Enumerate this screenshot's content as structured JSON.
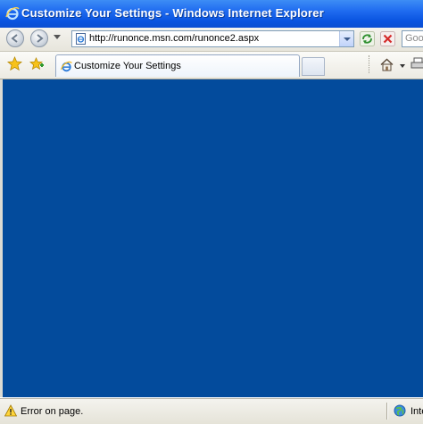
{
  "window": {
    "title": "Customize Your Settings - Windows Internet Explorer",
    "icon": "ie-logo-icon"
  },
  "address_bar": {
    "url": "http://runonce.msn.com/runonce2.aspx",
    "page_icon": "page-icon"
  },
  "search": {
    "placeholder": "Goo"
  },
  "tabs": [
    {
      "label": "Customize Your Settings",
      "icon": "ie-page-icon"
    }
  ],
  "status_bar": {
    "message": "Error on page.",
    "message_icon": "warning-icon",
    "zone": "Inte",
    "zone_icon": "globe-icon"
  },
  "colors": {
    "content_background": "#034b9c",
    "title_bar": "#0a54e0"
  }
}
